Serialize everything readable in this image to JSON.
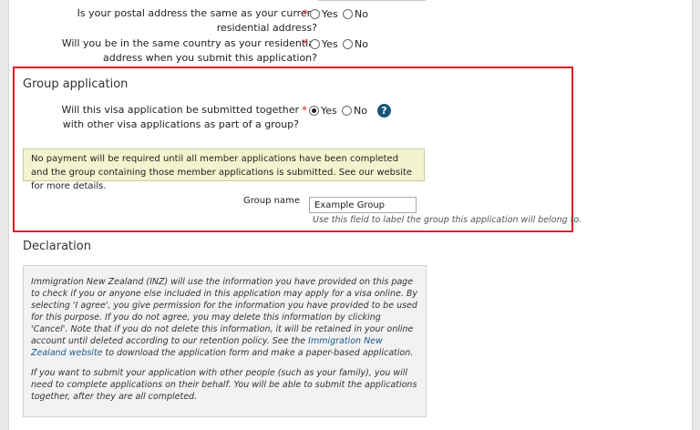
{
  "questions": {
    "postal": {
      "label": "Is your postal address the same as your current residential address?",
      "yes": "Yes",
      "no": "No"
    },
    "country": {
      "label": "Will you be in the same country as your residential address when you submit this application?",
      "yes": "Yes",
      "no": "No"
    }
  },
  "required_marker": "*",
  "group": {
    "title": "Group application",
    "question": "Will this visa application be submitted together with other visa applications as part of a group?",
    "yes": "Yes",
    "no": "No",
    "selected": "Yes",
    "help_icon": "?",
    "notice": "No payment will be required until all member applications have been completed and the group containing those member applications is submitted. See our website for more details.",
    "name_label": "Group name",
    "name_value": "Example Group",
    "name_hint": "Use this field to label the group this application will belong to."
  },
  "declaration": {
    "title": "Declaration",
    "para1_before": "Immigration New Zealand (INZ) will use the information you have provided on this page to check if you or anyone else included in this application may apply for a visa online. By selecting 'I agree', you give permission for the information you have provided to be used for this purpose.  If you do not agree, you may delete this information by clicking 'Cancel'. Note that if you do not delete this information, it will be retained in your online account until deleted according to our retention policy. See the ",
    "para1_link": "Immigration New Zealand website",
    "para1_after": " to download the application form and make a paper-based application.",
    "para2": "If you want to submit your application with other people (such as your family), you will need to complete applications on their behalf. You will be able to submit the applications together, after they are all completed."
  },
  "colors": {
    "highlight_border": "#e01f26",
    "required": "#d12e2e",
    "notice_bg": "#f3f4cf",
    "help_icon": "#14557b",
    "link": "#1a5a8a"
  }
}
